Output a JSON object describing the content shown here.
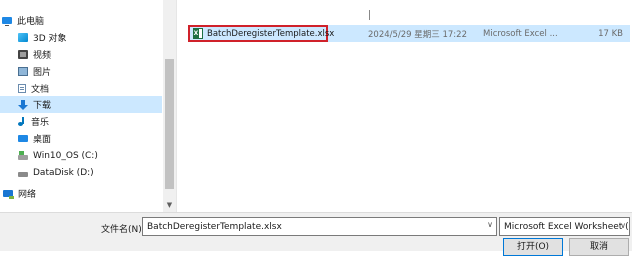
{
  "sidebar": {
    "items": [
      {
        "label": "此电脑",
        "icon": "computer-icon"
      },
      {
        "label": "3D 对象",
        "icon": "3d-objects-icon"
      },
      {
        "label": "视频",
        "icon": "video-icon"
      },
      {
        "label": "图片",
        "icon": "picture-icon"
      },
      {
        "label": "文档",
        "icon": "document-icon"
      },
      {
        "label": "下载",
        "icon": "download-icon",
        "selected": true
      },
      {
        "label": "音乐",
        "icon": "music-icon"
      },
      {
        "label": "桌面",
        "icon": "desktop-icon"
      },
      {
        "label": "Win10_OS (C:)",
        "icon": "drive-c-icon"
      },
      {
        "label": "DataDisk (D:)",
        "icon": "drive-d-icon"
      },
      {
        "label": "网络",
        "icon": "network-icon"
      }
    ]
  },
  "file_list": {
    "rows": [
      {
        "name": "BatchDeregisterTemplate.xlsx",
        "modified": "2024/5/29 星期三 17:22",
        "type": "Microsoft Excel ...",
        "size": "17 KB",
        "icon": "excel-file-icon",
        "selected": true
      }
    ]
  },
  "bottom": {
    "filename_label": "文件名(N):",
    "filename_value": "BatchDeregisterTemplate.xlsx",
    "filetype_value": "Microsoft Excel Worksheet (",
    "open_button": "打开(O)",
    "cancel_button": "取消"
  },
  "colors": {
    "selection": "#cce8ff",
    "highlight_border": "#d0212a",
    "panel": "#f0f0f0",
    "excel_green": "#1d6f42"
  }
}
